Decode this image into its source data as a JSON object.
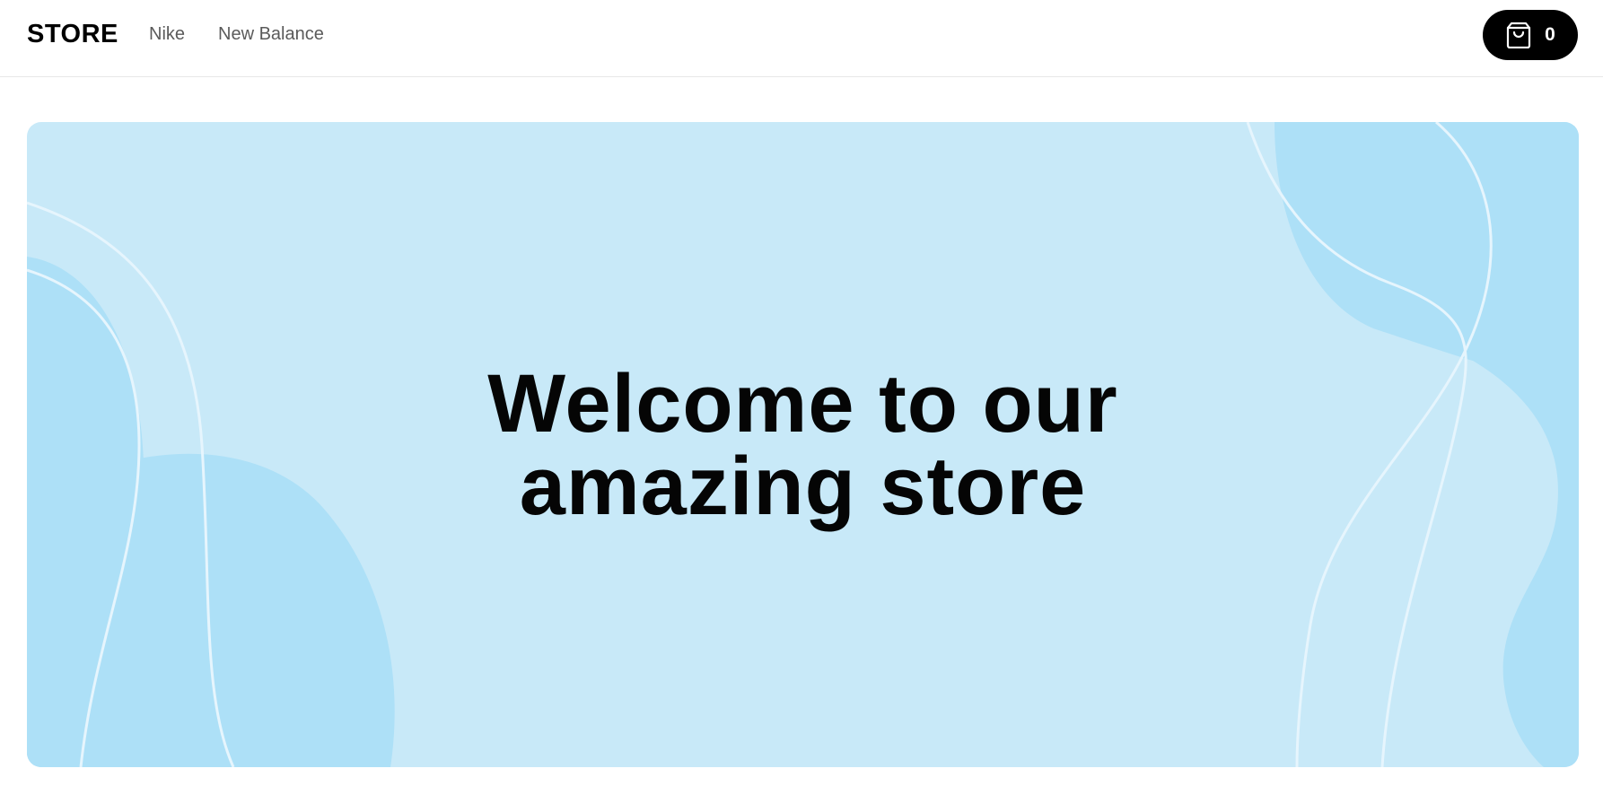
{
  "navbar": {
    "brand": "STORE",
    "links": [
      {
        "label": "Nike"
      },
      {
        "label": "New Balance"
      }
    ],
    "cart": {
      "icon": "shopping-bag-icon",
      "count": "0"
    }
  },
  "hero": {
    "title_line1": "Welcome to our",
    "title_line2": "amazing store",
    "colors": {
      "background": "#c8e9f8",
      "blob": "#ade0f7",
      "wave": "#e6f5fd"
    }
  }
}
